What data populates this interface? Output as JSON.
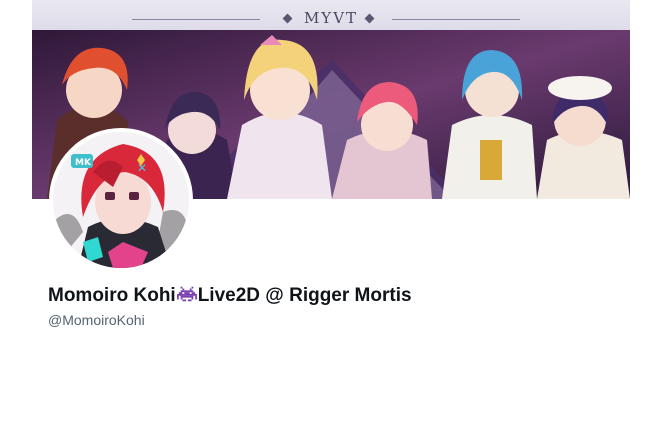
{
  "banner": {
    "title": "MYVT"
  },
  "profile": {
    "name_before_emoji": "Momoiro Kohi",
    "name_emoji": "space-invader-icon",
    "name_after_emoji": "Live2D @ Rigger Mortis",
    "handle": "@MomoiroKohi"
  },
  "colors": {
    "name_text": "#0f1419",
    "handle_text": "#536471",
    "emoji_purple": "#7b3fb0"
  }
}
